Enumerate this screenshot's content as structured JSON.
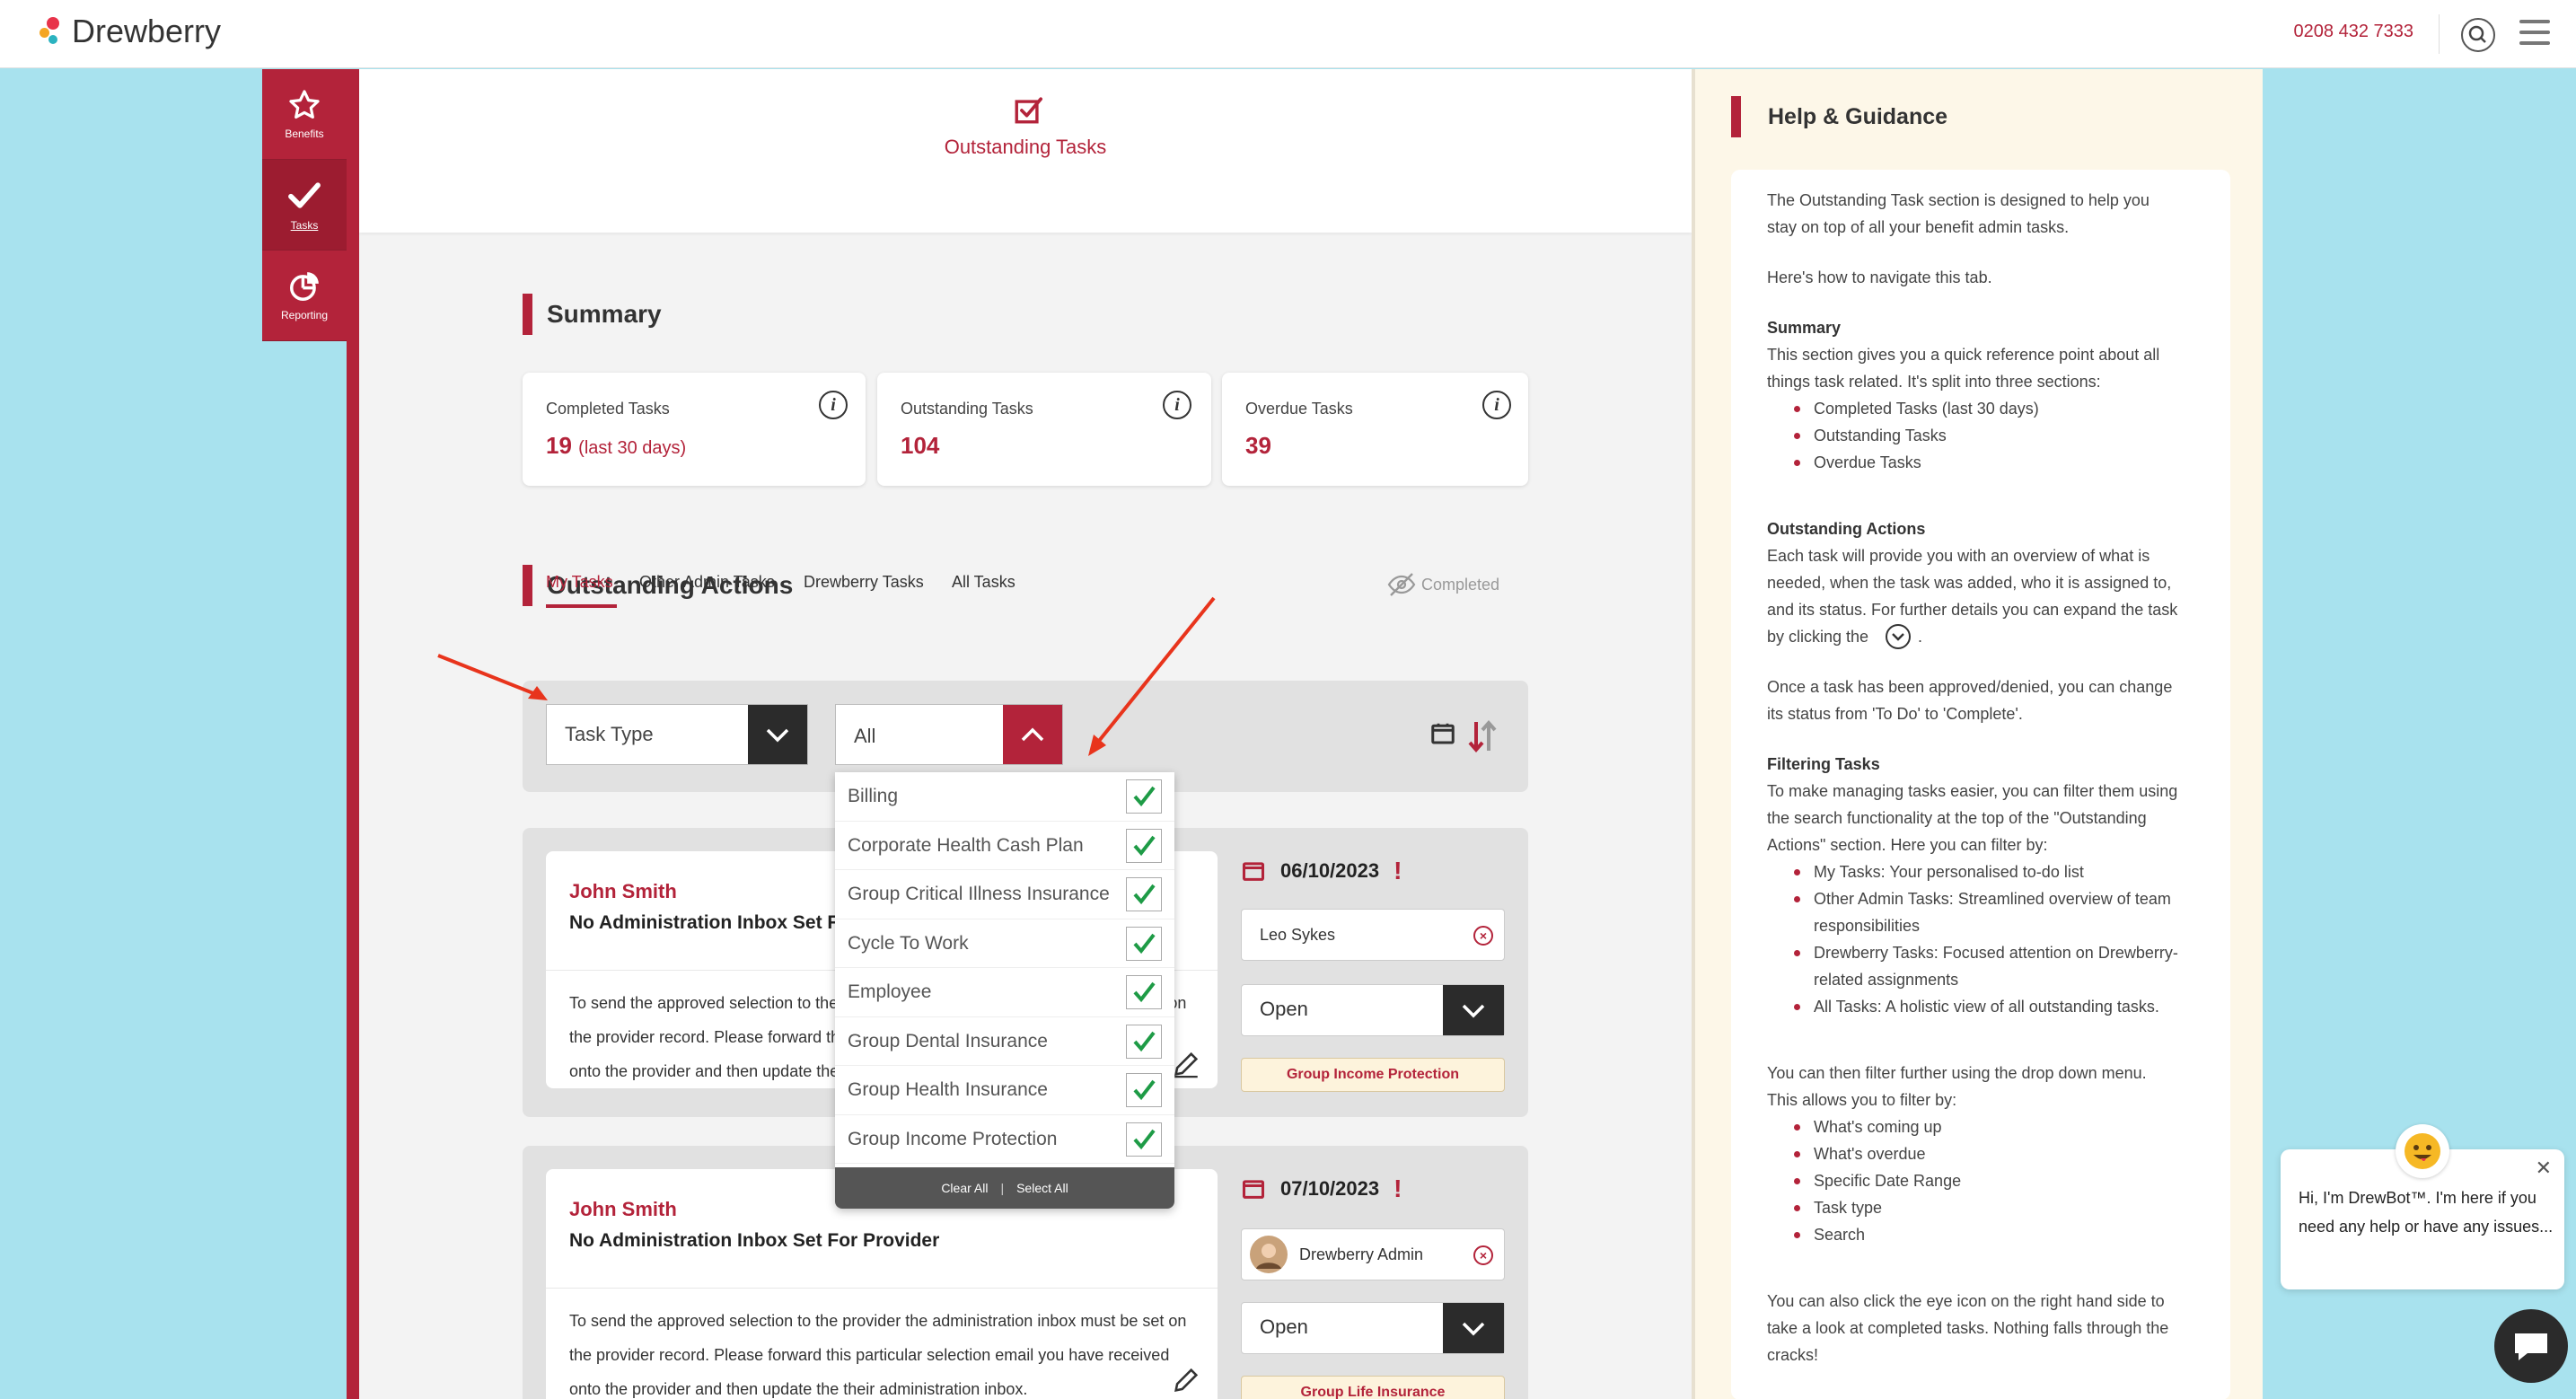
{
  "header": {
    "logo_text": "Drewberry",
    "phone": "0208 432 7333"
  },
  "sidebar": {
    "items": [
      {
        "label": "Benefits"
      },
      {
        "label": "Tasks"
      },
      {
        "label": "Reporting"
      }
    ]
  },
  "page": {
    "title": "Outstanding Tasks"
  },
  "summary": {
    "heading": "Summary",
    "cards": [
      {
        "label": "Completed Tasks",
        "value": "19",
        "sub": "(last 30 days)"
      },
      {
        "label": "Outstanding Tasks",
        "value": "104",
        "sub": ""
      },
      {
        "label": "Overdue Tasks",
        "value": "39",
        "sub": ""
      }
    ]
  },
  "actions": {
    "heading": "Outstanding Actions",
    "tabs": [
      "My Tasks",
      "Other Admin Tasks",
      "Drewberry Tasks",
      "All Tasks"
    ],
    "completed_label": "Completed",
    "filter": {
      "task_type_placeholder": "Task Type",
      "selected": "All",
      "options": [
        "Billing",
        "Corporate Health Cash Plan",
        "Group Critical Illness Insurance",
        "Cycle To Work",
        "Employee",
        "Group Dental Insurance",
        "Group Health Insurance",
        "Group Income Protection"
      ],
      "clear_all": "Clear All",
      "select_all": "Select All"
    },
    "tasks": [
      {
        "name": "John Smith",
        "title": "No Administration Inbox Set For Provider",
        "description": "To send the approved selection to the provider the administration inbox must be set on the provider record. Please forward this particular selection email you have received onto the provider and then update the their administration inbox.",
        "date": "06/10/2023",
        "assignee": "Leo Sykes",
        "status": "Open",
        "tag": "Group Income Protection"
      },
      {
        "name": "John Smith",
        "title": "No Administration Inbox Set For Provider",
        "description": "To send the approved selection to the provider the administration inbox must be set on the provider record. Please forward this particular selection email you have received onto the provider and then update the their administration inbox.",
        "date": "07/10/2023",
        "assignee": "Drewberry Admin",
        "status": "Open",
        "tag": "Group Life Insurance"
      }
    ]
  },
  "help": {
    "title": "Help & Guidance",
    "lines": [
      {
        "t": "The Outstanding Task section is designed to help you",
        "k": "p"
      },
      {
        "t": "stay on top of all your benefit admin tasks.",
        "k": "p"
      },
      {
        "t": "Here's how to navigate this tab.",
        "k": "p"
      },
      {
        "t": "Summary",
        "k": "b"
      },
      {
        "t": "This section gives you a quick reference point about all",
        "k": "p"
      },
      {
        "t": "things task related. It's split into three sections:",
        "k": "p"
      },
      {
        "t": "Completed Tasks (last 30 days)",
        "k": "li"
      },
      {
        "t": "Outstanding Tasks",
        "k": "li"
      },
      {
        "t": "Overdue Tasks",
        "k": "li"
      },
      {
        "t": "Outstanding Actions",
        "k": "b"
      },
      {
        "t": "Each task will provide you with an overview of what is",
        "k": "p"
      },
      {
        "t": "needed, when the task was added, who it is assigned to,",
        "k": "p"
      },
      {
        "t": "and its status. For further details you can expand the task",
        "k": "p"
      },
      {
        "t": "by clicking the",
        "k": "p",
        "tail": "."
      },
      {
        "t": "Once a task has been approved/denied, you can change",
        "k": "p"
      },
      {
        "t": "its status from 'To Do' to 'Complete'.",
        "k": "p"
      },
      {
        "t": "Filtering Tasks",
        "k": "b"
      },
      {
        "t": "To make managing tasks easier, you can filter them using",
        "k": "p"
      },
      {
        "t": "the search functionality at the top of the \"Outstanding",
        "k": "p"
      },
      {
        "t": "Actions\" section. Here you can filter by:",
        "k": "p"
      },
      {
        "t": "My Tasks: Your personalised to-do list",
        "k": "li"
      },
      {
        "t": "Other Admin Tasks: Streamlined overview of team",
        "k": "li"
      },
      {
        "t": "responsibilities",
        "k": "li2"
      },
      {
        "t": "Drewberry Tasks: Focused attention on Drewberry-",
        "k": "li"
      },
      {
        "t": "related assignments",
        "k": "li2"
      },
      {
        "t": "All Tasks: A holistic view of all outstanding tasks.",
        "k": "li"
      },
      {
        "t": "You can then filter further using the drop down menu.",
        "k": "p"
      },
      {
        "t": "This allows you to filter by:",
        "k": "p"
      },
      {
        "t": "What's coming up",
        "k": "li"
      },
      {
        "t": "What's overdue",
        "k": "li"
      },
      {
        "t": "Specific Date Range",
        "k": "li"
      },
      {
        "t": "Task type",
        "k": "li"
      },
      {
        "t": "Search",
        "k": "li"
      },
      {
        "t": "You can also click the eye icon on the right hand side to",
        "k": "p"
      },
      {
        "t": "take a look at completed tasks. Nothing falls through the",
        "k": "p"
      },
      {
        "t": "cracks!",
        "k": "p"
      }
    ]
  },
  "chat": {
    "message": "Hi, I'm DrewBot™. I'm here if you need any help or have any issues..."
  },
  "colors": {
    "brand": "#b3233a",
    "background": "#a8e2ee",
    "help_background": "#fdf7e8"
  }
}
